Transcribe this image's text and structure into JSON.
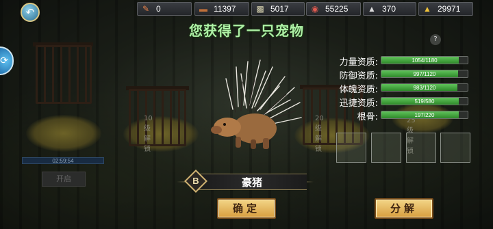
{
  "resources": [
    {
      "icon": "scroll-icon",
      "value": "0"
    },
    {
      "icon": "wood-icon",
      "value": "11397"
    },
    {
      "icon": "stone-icon",
      "value": "5017"
    },
    {
      "icon": "meat-icon",
      "value": "55225"
    },
    {
      "icon": "silver-icon",
      "value": "370"
    },
    {
      "icon": "gold-icon",
      "value": "29971"
    }
  ],
  "title": "您获得了一只宠物",
  "help": "?",
  "cages": {
    "cage2_label": "10级解锁",
    "cage3_label": "20级解锁",
    "cage4_label": "25级解锁"
  },
  "timer": "02:59:54",
  "open_button": "开启",
  "pet": {
    "grade": "B",
    "name": "豪猪"
  },
  "stats": [
    {
      "label": "力量资质:",
      "text": "1054/1180",
      "value": 1054,
      "max": 1180
    },
    {
      "label": "防御资质:",
      "text": "997/1120",
      "value": 997,
      "max": 1120
    },
    {
      "label": "体魄资质:",
      "text": "983/1120",
      "value": 983,
      "max": 1120
    },
    {
      "label": "迅捷资质:",
      "text": "519/580",
      "value": 519,
      "max": 580
    },
    {
      "label": "根骨:",
      "text": "197/220",
      "value": 197,
      "max": 220
    }
  ],
  "buttons": {
    "confirm": "确定",
    "decompose": "分解"
  },
  "colors": {
    "title": "#aef1a6",
    "stat_fill": "#4fb04a",
    "button": "#e9bb62"
  }
}
